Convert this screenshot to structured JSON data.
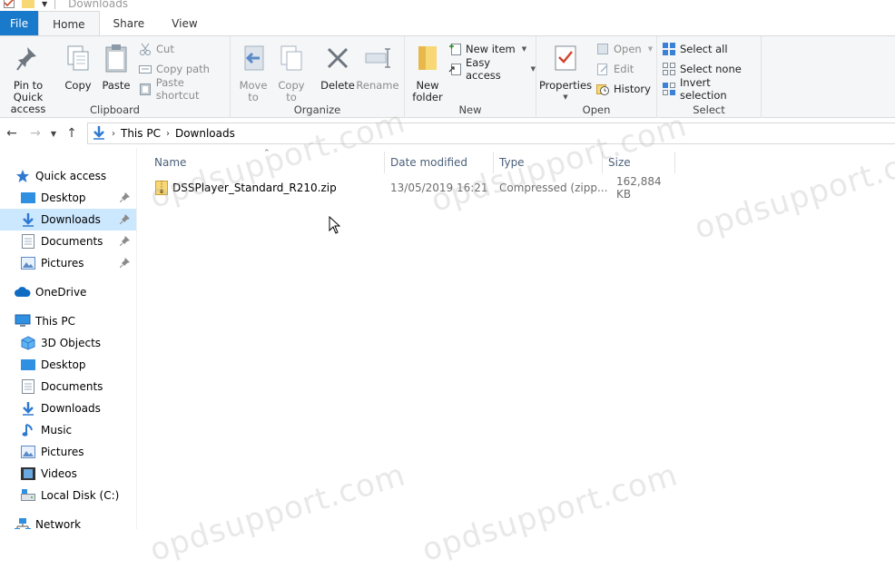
{
  "window": {
    "title": "Downloads"
  },
  "tabs": [
    "File",
    "Home",
    "Share",
    "View"
  ],
  "ribbon": {
    "clipboard": {
      "label": "Clipboard",
      "pin": "Pin to Quick\naccess",
      "copy": "Copy",
      "paste": "Paste",
      "cut": "Cut",
      "copy_path": "Copy path",
      "paste_shortcut": "Paste shortcut"
    },
    "organize": {
      "label": "Organize",
      "move_to": "Move\nto",
      "copy_to": "Copy\nto",
      "delete": "Delete",
      "rename": "Rename"
    },
    "new": {
      "label": "New",
      "new_folder": "New\nfolder",
      "new_item": "New item",
      "easy_access": "Easy access"
    },
    "open": {
      "label": "Open",
      "properties": "Properties",
      "open": "Open",
      "edit": "Edit",
      "history": "History"
    },
    "select": {
      "label": "Select",
      "select_all": "Select all",
      "select_none": "Select none",
      "invert_selection": "Invert selection"
    }
  },
  "address": {
    "crumbs": [
      "This PC",
      "Downloads"
    ]
  },
  "nav": {
    "quick_access": "Quick access",
    "quick_items": [
      "Desktop",
      "Downloads",
      "Documents",
      "Pictures"
    ],
    "onedrive": "OneDrive",
    "this_pc": "This PC",
    "pc_items": [
      "3D Objects",
      "Desktop",
      "Documents",
      "Downloads",
      "Music",
      "Pictures",
      "Videos",
      "Local Disk (C:)"
    ],
    "network": "Network"
  },
  "columns": {
    "name": "Name",
    "date": "Date modified",
    "type": "Type",
    "size": "Size"
  },
  "files": [
    {
      "name": "DSSPlayer_Standard_R210.zip",
      "date": "13/05/2019 16:21",
      "type": "Compressed (zipp...",
      "size": "162,884 KB"
    }
  ],
  "watermark": "opdsupport.com"
}
